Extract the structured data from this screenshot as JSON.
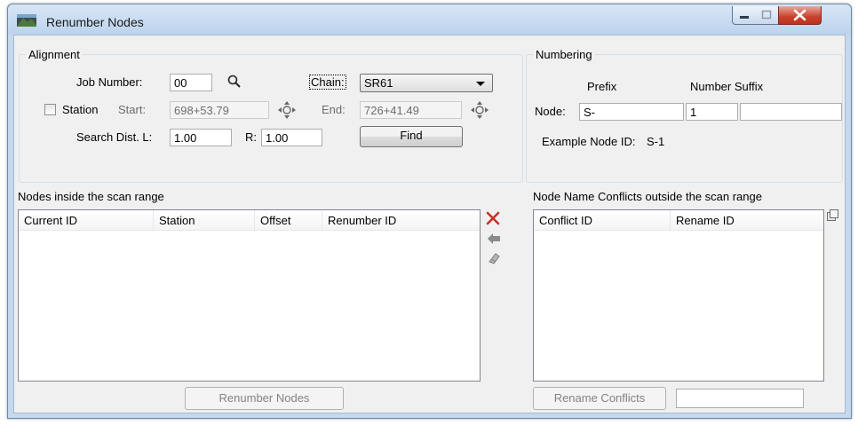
{
  "window": {
    "title": "Renumber Nodes"
  },
  "alignment": {
    "legend": "Alignment",
    "job_number_label": "Job Number:",
    "job_number_value": "00",
    "chain_label": "Chain:",
    "chain_value": "SR61",
    "station_label": "Station",
    "station_checked": false,
    "start_label": "Start:",
    "start_value": "698+53.79",
    "end_label": "End:",
    "end_value": "726+41.49",
    "search_dist_label": "Search Dist. L:",
    "search_dist_l": "1.00",
    "r_label": "R:",
    "search_dist_r": "1.00",
    "find_label": "Find"
  },
  "numbering": {
    "legend": "Numbering",
    "prefix_header": "Prefix",
    "number_suffix_header": "Number Suffix",
    "node_label": "Node:",
    "prefix_value": "S-",
    "number_value": "1",
    "suffix_value": "",
    "example_label": "Example Node ID:",
    "example_value": "S-1"
  },
  "nodes_panel": {
    "title": "Nodes inside the scan range",
    "columns": [
      "Current ID",
      "Station",
      "Offset",
      "Renumber ID"
    ],
    "rows": [],
    "renumber_button": "Renumber Nodes"
  },
  "conflicts_panel": {
    "title": "Node Name Conflicts outside the scan range",
    "columns": [
      "Conflict ID",
      "Rename ID"
    ],
    "rows": [],
    "rename_button": "Rename Conflicts",
    "rename_input": ""
  },
  "icons": {
    "app": "map-road-icon",
    "search": "magnifier-icon",
    "pick_start": "crosshair-target-icon",
    "pick_end": "crosshair-target-icon",
    "delete": "red-x-icon",
    "move_left": "arrow-left-icon",
    "clear": "eraser-icon",
    "copy": "copy-window-icon"
  },
  "colors": {
    "delete_icon": "#c8312a",
    "title_bar": "#c4d8ee"
  }
}
